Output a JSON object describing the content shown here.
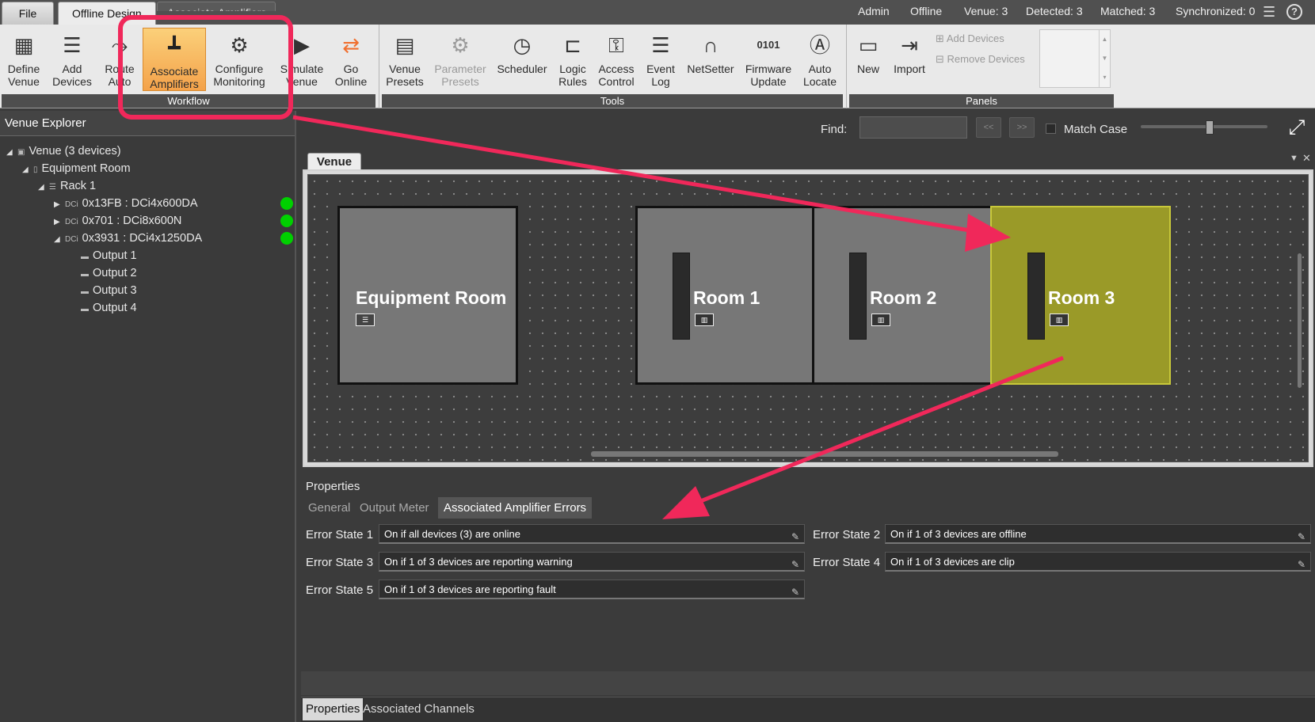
{
  "app": {
    "tabs": [
      {
        "label": "File"
      },
      {
        "label": "Offline Design"
      },
      {
        "label": "Associate Amplifiers"
      }
    ],
    "status": {
      "user": "Admin",
      "mode": "Offline",
      "venue": "Venue: 3",
      "detected": "Detected: 3",
      "matched": "Matched: 3",
      "synchronized": "Synchronized: 0"
    }
  },
  "ribbon": {
    "workflow": {
      "label": "Workflow",
      "buttons": [
        {
          "label": "Define\nVenue",
          "icon": "define-venue-icon"
        },
        {
          "label": "Add\nDevices",
          "icon": "add-devices-icon"
        },
        {
          "label": "Route\nAuto",
          "icon": "route-auto-icon"
        },
        {
          "label": "Associate\nAmplifiers",
          "icon": "associate-amplifiers-icon"
        },
        {
          "label": "Configure\nMonitoring",
          "icon": "configure-monitoring-icon"
        },
        {
          "label": "Simulate\nVenue",
          "icon": "simulate-venue-icon"
        },
        {
          "label": "Go\nOnline",
          "icon": "go-online-icon"
        }
      ]
    },
    "tools": {
      "label": "Tools",
      "buttons": [
        {
          "label": "Venue\nPresets",
          "icon": "venue-presets-icon"
        },
        {
          "label": "Parameter\nPresets",
          "icon": "parameter-presets-icon"
        },
        {
          "label": "Scheduler",
          "icon": "clock-icon"
        },
        {
          "label": "Logic\nRules",
          "icon": "logic-rules-icon"
        },
        {
          "label": "Access\nControl",
          "icon": "key-icon"
        },
        {
          "label": "Event\nLog",
          "icon": "list-icon"
        },
        {
          "label": "NetSetter",
          "icon": "netsetter-icon"
        },
        {
          "label": "Firmware\nUpdate",
          "icon": "firmware-icon"
        },
        {
          "label": "Auto\nLocate",
          "icon": "auto-locate-icon"
        }
      ]
    },
    "panels": {
      "label": "Panels",
      "new_label": "New",
      "import_label": "Import",
      "add_devices_label": "Add Devices",
      "remove_devices_label": "Remove Devices"
    }
  },
  "explorer": {
    "title": "Venue Explorer",
    "tree": [
      {
        "label": "Venue (3 devices)"
      },
      {
        "label": "Equipment Room"
      },
      {
        "label": "Rack 1"
      },
      {
        "prefix": "DCi",
        "label": "0x13FB : DCi4x600DA"
      },
      {
        "prefix": "DCi",
        "label": "0x701 : DCi8x600N"
      },
      {
        "prefix": "DCi",
        "label": "0x3931 : DCi4x1250DA"
      },
      {
        "label": "Output 1"
      },
      {
        "label": "Output 2"
      },
      {
        "label": "Output 3"
      },
      {
        "label": "Output 4"
      }
    ]
  },
  "find": {
    "label": "Find:",
    "prev": "<<",
    "next": ">>",
    "match_case": "Match Case"
  },
  "venue_tab": "Venue",
  "canvas": {
    "rooms": [
      {
        "name": "Equipment Room"
      },
      {
        "name": "Room 1"
      },
      {
        "name": "Room 2"
      },
      {
        "name": "Room 3"
      }
    ],
    "highlight_color": "#9a9a28"
  },
  "properties": {
    "title": "Properties",
    "tabs": [
      {
        "label": "General"
      },
      {
        "label": "Output Meter"
      },
      {
        "label": "Associated Amplifier Errors"
      }
    ],
    "errors": [
      {
        "label": "Error State 1",
        "value": "On if all devices (3) are online"
      },
      {
        "label": "Error State 2",
        "value": "On if 1 of 3 devices are offline"
      },
      {
        "label": "Error State 3",
        "value": "On if 1 of 3 devices are reporting warning"
      },
      {
        "label": "Error State 4",
        "value": "On if 1 of 3 devices are clip"
      },
      {
        "label": "Error State 5",
        "value": "On if 1 of 3 devices are reporting fault"
      }
    ]
  },
  "bottom_tabs": [
    {
      "label": "Properties"
    },
    {
      "label": "Associated Channels"
    }
  ],
  "annotation_color": "#f0285a"
}
